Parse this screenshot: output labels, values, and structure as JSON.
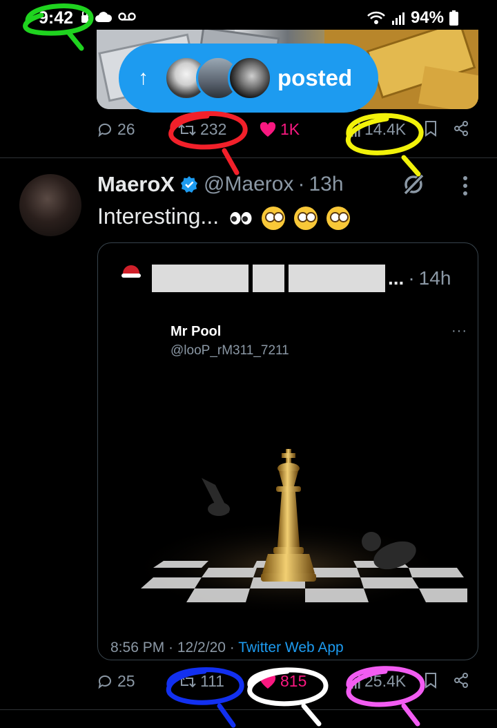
{
  "status_bar": {
    "time": "9:42",
    "battery": "94%",
    "icons": [
      "lock-icon",
      "cloud-icon",
      "voicemail-icon",
      "wifi-icon",
      "signal-icon",
      "battery-icon"
    ]
  },
  "previous_tweet": {
    "posted_banner": {
      "label": "posted",
      "avatar_count": 3
    },
    "actions": {
      "replies": "26",
      "retweets": "232",
      "likes": "1K",
      "views": "14.4K"
    }
  },
  "tweet": {
    "author_name": "MaeroX",
    "handle": "@Maerox",
    "separator": "·",
    "time": "13h",
    "text": "Interesting...",
    "emoji": [
      "eyes",
      "face-with-rolling-eyes",
      "face-with-rolling-eyes",
      "face-with-rolling-eyes"
    ],
    "quote": {
      "ellipsis": "...",
      "separator": "·",
      "time": "14h",
      "embed_name": "Mr Pool",
      "embed_handle": "@looP_rM311_7211",
      "embed_more": "···",
      "footer_datetime": "8:56 PM · 12/2/20 · ",
      "footer_source": "Twitter Web App"
    },
    "actions": {
      "replies": "25",
      "retweets": "111",
      "likes": "815",
      "views": "25.4K"
    }
  },
  "colors": {
    "background": "#000000",
    "accent_blue": "#1d9bf0",
    "like_pink": "#f91880",
    "muted": "#8b98a5",
    "mark_green": "#1fd31f",
    "mark_red": "#f2202a",
    "mark_yellow": "#f2f20a",
    "mark_blue": "#1230f0",
    "mark_white": "#ffffff",
    "mark_magenta": "#f25cf2"
  }
}
